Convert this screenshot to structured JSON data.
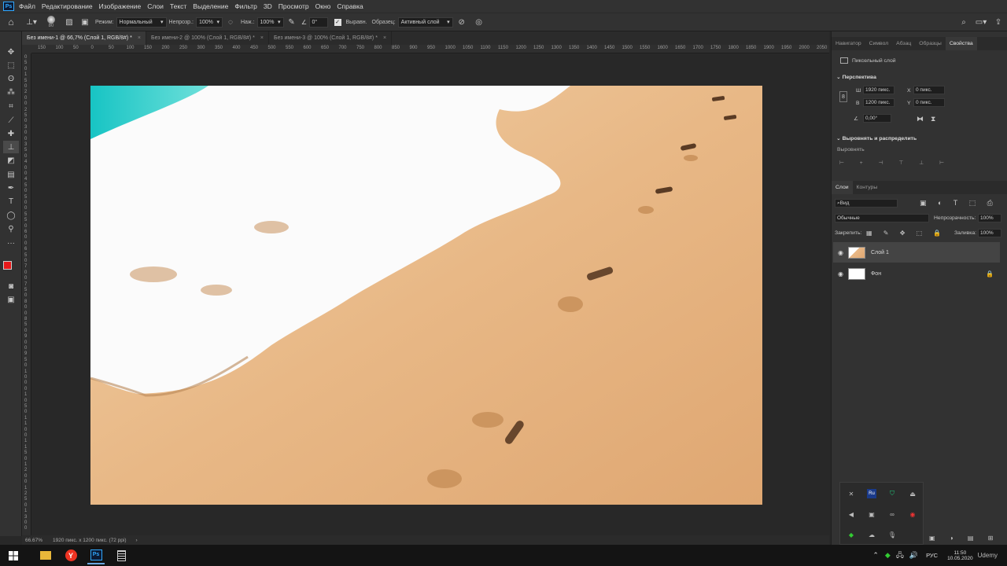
{
  "menubar": {
    "logo": "Ps",
    "items": [
      "Файл",
      "Редактирование",
      "Изображение",
      "Слои",
      "Текст",
      "Выделение",
      "Фильтр",
      "3D",
      "Просмотр",
      "Окно",
      "Справка"
    ]
  },
  "options": {
    "brush_size": "80",
    "mode_label": "Режим:",
    "mode_value": "Нормальный",
    "opacity_label": "Непрозр.:",
    "opacity_value": "100%",
    "pressure_label": "Наж.:",
    "pressure_value": "100%",
    "angle_value": "0°",
    "align_label": "Выравн.",
    "sample_label": "Образец:",
    "sample_value": "Активный слой"
  },
  "tabs": [
    {
      "label": "Без имени-1 @ 66,7% (Слой 1, RGB/8#) *",
      "close": "×"
    },
    {
      "label": "Без имени-2 @ 100% (Слой 1, RGB/8#) *",
      "close": "×"
    },
    {
      "label": "Без имени-3 @ 100% (Слой 1, RGB/8#) *",
      "close": "×"
    }
  ],
  "ruler": {
    "h_ticks": [
      "150",
      "100",
      "50",
      "0",
      "50",
      "100",
      "150",
      "200",
      "250",
      "300",
      "350",
      "400",
      "450",
      "500",
      "550",
      "600",
      "650",
      "700",
      "750",
      "800",
      "850",
      "900",
      "950",
      "1000",
      "1050",
      "1100",
      "1150",
      "1200",
      "1250",
      "1300",
      "1350",
      "1400",
      "1450",
      "1500",
      "1550",
      "1600",
      "1650",
      "1700",
      "1750",
      "1800",
      "1850",
      "1900",
      "1950",
      "2000",
      "2050"
    ],
    "v_ticks": [
      "0",
      "5",
      "0",
      "1",
      "5",
      "0",
      "2",
      "0",
      "0",
      "2",
      "5",
      "0",
      "3",
      "0",
      "0",
      "3",
      "5",
      "0",
      "4",
      "0",
      "0",
      "4",
      "5",
      "0",
      "5",
      "0",
      "0",
      "5",
      "5",
      "0",
      "6",
      "0",
      "0",
      "6",
      "5",
      "0",
      "7",
      "0",
      "0",
      "7",
      "5",
      "0",
      "8",
      "0",
      "0",
      "8",
      "5",
      "0",
      "9",
      "0",
      "0",
      "9",
      "5",
      "0",
      "1",
      "0",
      "0",
      "0",
      "1",
      "0",
      "5",
      "0",
      "1",
      "1",
      "0",
      "0",
      "1",
      "1",
      "5",
      "0",
      "1",
      "2",
      "0",
      "0",
      "1",
      "2",
      "5",
      "0",
      "1",
      "3",
      "0",
      "0"
    ]
  },
  "status": {
    "zoom": "66.67%",
    "doc_info": "1920 пикс. x 1200 пикс. (72 ppi)",
    "arrow": "›"
  },
  "panel_tabs": [
    "Навигатор",
    "Символ",
    "Абзац",
    "Образцы",
    "Свойства"
  ],
  "properties": {
    "layer_type": "Пиксельный слой",
    "perspective_title": "Перспектива",
    "w_label": "Ш",
    "w_value": "1920 пикс.",
    "x_label": "X",
    "x_value": "0 пикс.",
    "h_label": "В",
    "h_value": "1200 пикс.",
    "y_label": "Y",
    "y_value": "0 пикс.",
    "angle_value": "0,00°",
    "align_title": "Выровнять и распределить",
    "align_sub": "Выровнять"
  },
  "layers_panel": {
    "tabs": [
      "Слои",
      "Контуры"
    ],
    "filter_value": "Вид",
    "blend_mode": "Обычные",
    "opacity_label": "Непрозрачность:",
    "opacity_value": "100%",
    "lock_label": "Закрепить:",
    "fill_label": "Заливка:",
    "fill_value": "100%",
    "layers": [
      {
        "name": "Слой 1",
        "selected": true,
        "locked": false
      },
      {
        "name": "Фон",
        "selected": false,
        "locked": true
      }
    ]
  },
  "tray": {
    "lang": "РУС",
    "time": "11:50",
    "date": "10.05.2020",
    "watermark": "Udemy"
  },
  "colors": {
    "foreground": "#e8191a",
    "background": "#000000",
    "accent": "#31a8ff"
  }
}
